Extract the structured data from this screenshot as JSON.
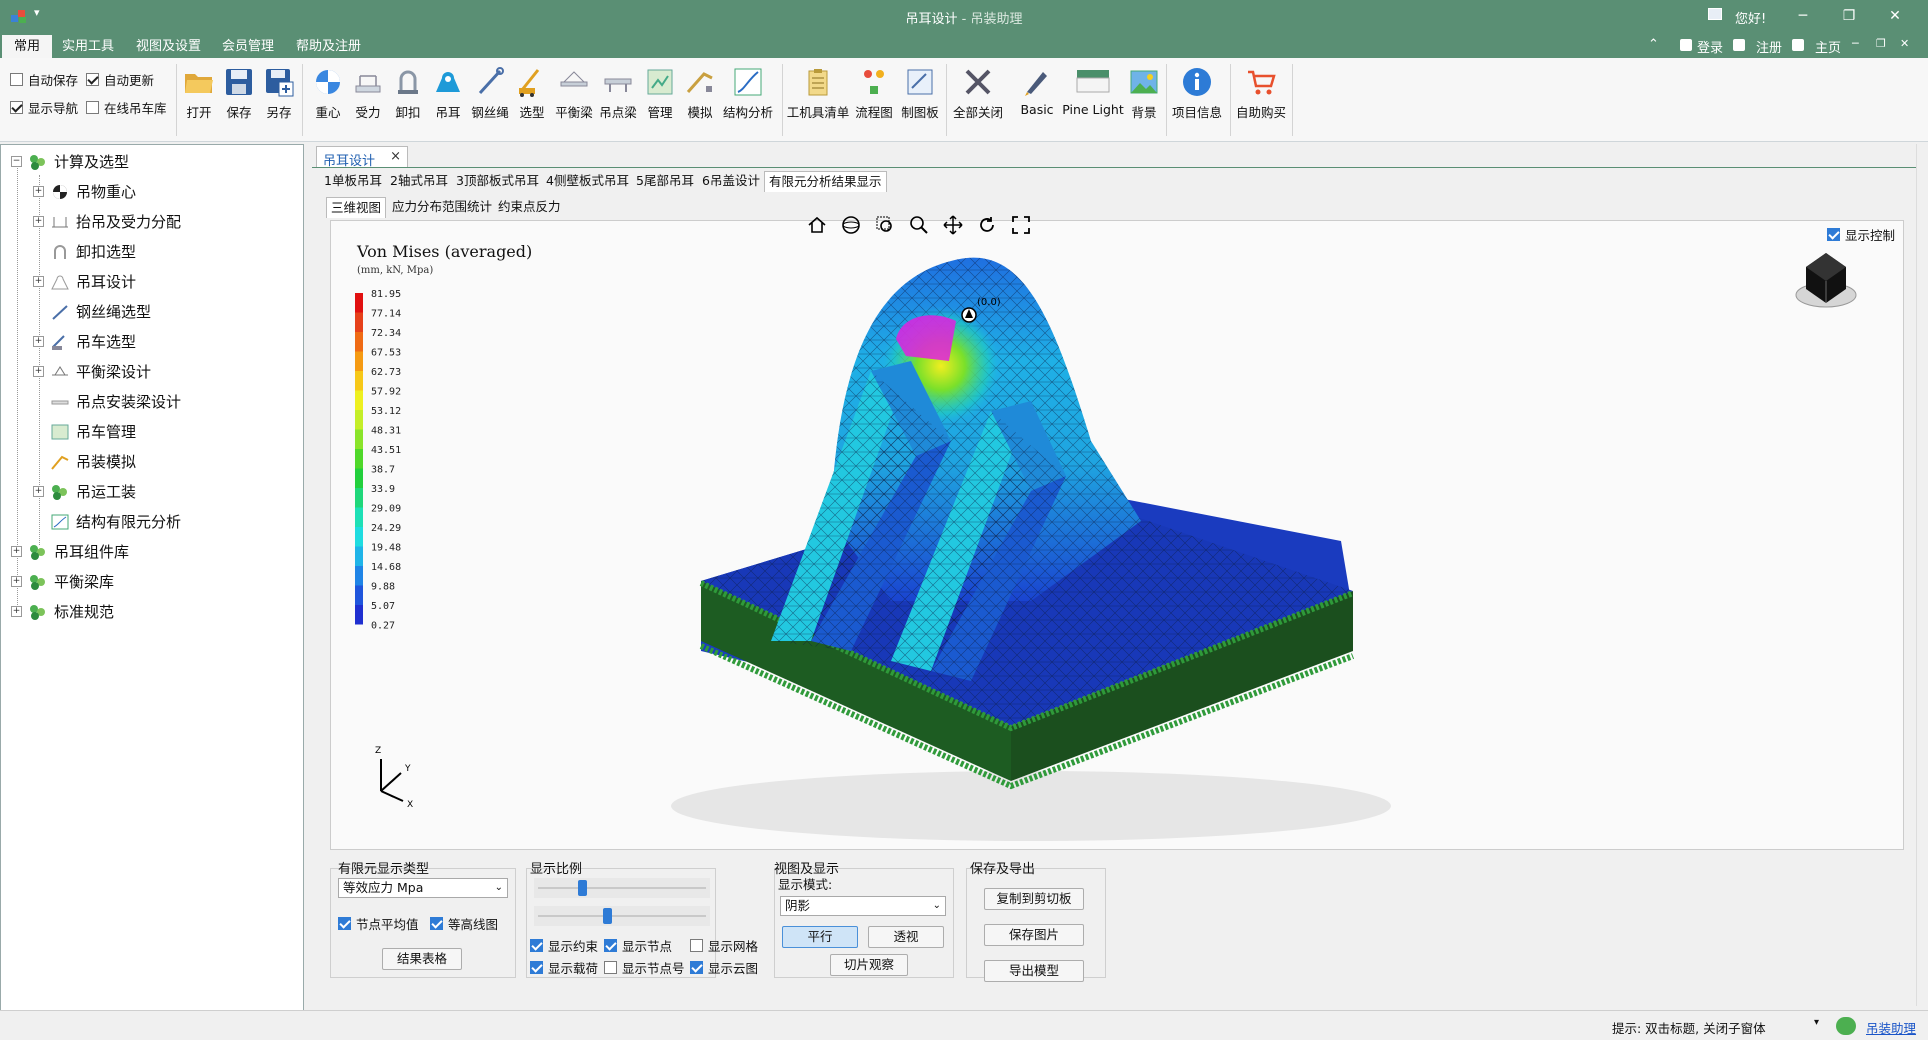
{
  "window": {
    "title": "吊耳设计",
    "subtitle": " - 吊装助理",
    "greeting": "您好!",
    "minimize": "─",
    "restore": "❐",
    "close": "✕"
  },
  "menu": {
    "tabs": [
      "常用",
      "实用工具",
      "视图及设置",
      "会员管理",
      "帮助及注册"
    ],
    "right": {
      "login": "登录",
      "register": "注册",
      "home": "主页"
    }
  },
  "ribbon": {
    "checkboxes": [
      {
        "label": "自动保存",
        "checked": false
      },
      {
        "label": "自动更新",
        "checked": true
      },
      {
        "label": "显示导航",
        "checked": true
      },
      {
        "label": "在线吊车库",
        "checked": false
      }
    ],
    "buttons": [
      "打开",
      "保存",
      "另存",
      "重心",
      "受力",
      "卸扣",
      "吊耳",
      "钢丝绳",
      "选型",
      "平衡梁",
      "吊点梁",
      "管理",
      "模拟",
      "结构分析",
      "工机具清单",
      "流程图",
      "制图板",
      "全部关闭",
      "Basic",
      "Pine Light",
      "背景",
      "项目信息",
      "自助购买"
    ]
  },
  "tree": {
    "root": "计算及选型",
    "children": [
      "吊物重心",
      "抬吊及受力分配",
      "卸扣选型",
      "吊耳设计",
      "钢丝绳选型",
      "吊车选型",
      "平衡梁设计",
      "吊点安装梁设计",
      "吊车管理",
      "吊装模拟",
      "吊运工装",
      "结构有限元分析"
    ],
    "others": [
      "吊耳组件库",
      "平衡梁库",
      "标准规范"
    ]
  },
  "doc": {
    "tab": "吊耳设计",
    "close": "×",
    "subtabs": [
      "1单板吊耳",
      "2轴式吊耳",
      "3顶部板式吊耳",
      "4侧壁板式吊耳",
      "5尾部吊耳",
      "6吊盖设计",
      "有限元分析结果显示"
    ],
    "viewtabs": [
      "三维视图",
      "应力分布范围统计",
      "约束点反力"
    ]
  },
  "viewport": {
    "legend_title": "Von Mises (averaged)",
    "legend_units": "(mm, kN, Mpa)",
    "legend_values": [
      "81.95",
      "77.14",
      "72.34",
      "67.53",
      "62.73",
      "57.92",
      "53.12",
      "48.31",
      "43.51",
      "38.7",
      "33.9",
      "29.09",
      "24.29",
      "19.48",
      "14.68",
      "9.88",
      "5.07",
      "0.27"
    ],
    "legend_colors": [
      "#e11010",
      "#e6401a",
      "#ef6a14",
      "#f59a12",
      "#f7c818",
      "#eef020",
      "#c4ee28",
      "#8ae42a",
      "#4fd82a",
      "#22cf3c",
      "#1fd77a",
      "#1ee0b6",
      "#1fdce0",
      "#1fb4e8",
      "#1f84e6",
      "#1f55dc",
      "#1f2fd0",
      "#1b10b8"
    ],
    "show_control": "显示控制",
    "node_label": "(0.0)",
    "axes": {
      "z": "Z",
      "y": "Y",
      "x": "X"
    },
    "toolbar_icons": [
      "home-icon",
      "orbit-icon",
      "zoom-window-icon",
      "zoom-icon",
      "pan-icon",
      "rotate-icon",
      "fullscreen-icon"
    ]
  },
  "panel": {
    "fe_type": {
      "title": "有限元显示类型",
      "combo_value": "等效应力 Mpa",
      "chk_node_avg": "节点平均值",
      "chk_contour": "等高线图",
      "button": "结果表格"
    },
    "scale": {
      "title": "显示比例",
      "slider1": 0.25,
      "slider2": 0.41
    },
    "display": {
      "show_constraint": "显示约束",
      "show_node": "显示节点",
      "show_mesh": "显示网格",
      "show_load": "显示载荷",
      "show_node_no": "显示节点号",
      "show_cloud": "显示云图"
    },
    "view": {
      "title": "视图及显示",
      "mode_label": "显示模式:",
      "mode_value": "阴影",
      "parallel": "平行",
      "perspective": "透视",
      "slice": "切片观察"
    },
    "export": {
      "title": "保存及导出",
      "copy": "复制到剪切板",
      "save_img": "保存图片",
      "export_model": "导出模型"
    }
  },
  "status": {
    "hint": "提示: 双击标题, 关闭子窗体",
    "link": "吊装助理"
  }
}
